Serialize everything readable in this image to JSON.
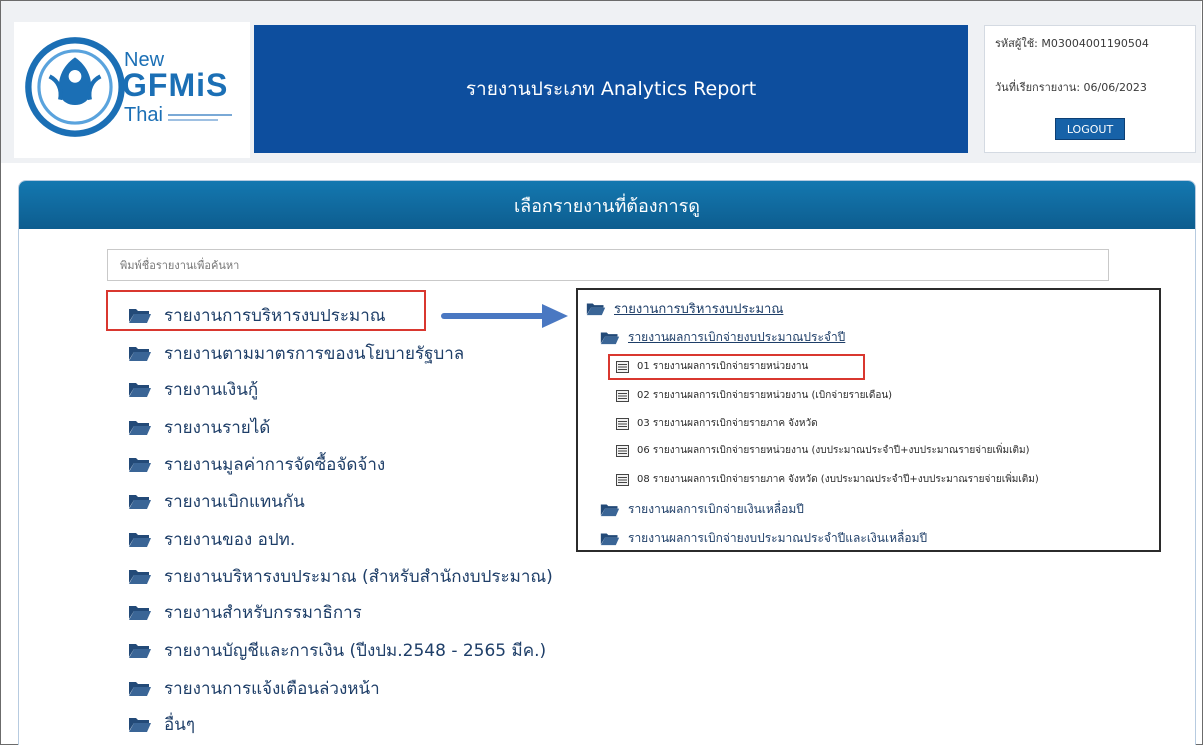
{
  "header": {
    "logo": {
      "line1": "New",
      "line2": "GFMiS",
      "line3": "Thai"
    },
    "title": "รายงานประเภท Analytics Report",
    "user": {
      "id_label": "รหัสผู้ใช้:",
      "id_value": "M03004001190504",
      "date_label": "วันที่เรียกรายงาน:",
      "date_value": "06/06/2023",
      "logout_label": "LOGOUT"
    }
  },
  "panel": {
    "title": "เลือกรายงานที่ต้องการดู",
    "search_placeholder": "พิมพ์ชื่อรายงานเพื่อค้นหา",
    "categories": [
      "รายงานการบริหารงบประมาณ",
      "รายงานตามมาตรการของนโยบายรัฐบาล",
      "รายงานเงินกู้",
      "รายงานรายได้",
      "รายงานมูลค่าการจัดซื้อจัดจ้าง",
      "รายงานเบิกแทนกัน",
      "รายงานของ อปท.",
      "รายงานบริหารงบประมาณ (สำหรับสำนักงบประมาณ)",
      "รายงานสำหรับกรรมาธิการ",
      "รายงานบัญชีและการเงิน (ปีงปม.2548 - 2565 มีค.)",
      "รายงานการแจ้งเตือนล่วงหน้า",
      "อื่นๆ"
    ]
  },
  "tree": {
    "root": "รายงานการบริหารงบประมาณ",
    "group1": "รายงานผลการเบิกจ่ายงบประมาณประจำปี",
    "reports": [
      "01 รายงานผลการเบิกจ่ายรายหน่วยงาน",
      "02 รายงานผลการเบิกจ่ายรายหน่วยงาน (เบิกจ่ายรายเดือน)",
      "03 รายงานผลการเบิกจ่ายรายภาค จังหวัด",
      "06 รายงานผลการเบิกจ่ายรายหน่วยงาน (งบประมาณประจำปี+งบประมาณรายจ่ายเพิ่มเติม)",
      "08 รายงานผลการเบิกจ่ายรายภาค จังหวัด (งบประมาณประจำปี+งบประมาณรายจ่ายเพิ่มเติม)"
    ],
    "group2": "รายงานผลการเบิกจ่ายเงินเหลื่อมปี",
    "group3": "รายงานผลการเบิกจ่ายงบประมาณประจำปีและเงินเหลื่อมปี"
  },
  "colors": {
    "brand_blue": "#0d4e9e",
    "panel_header": "#1478b0",
    "highlight_red": "#d9372f",
    "folder_icon": "#234a78"
  }
}
